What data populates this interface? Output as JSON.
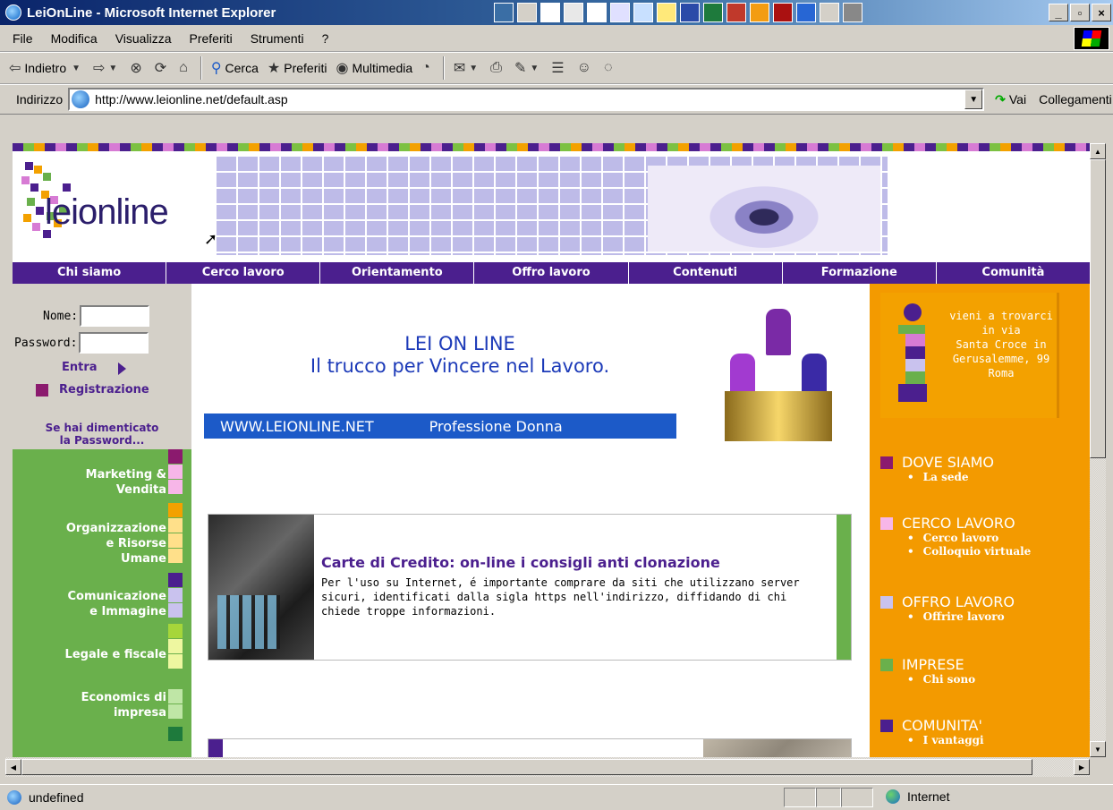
{
  "window": {
    "title": "LeiOnLine - Microsoft Internet Explorer"
  },
  "menubar": {
    "items": [
      "File",
      "Modifica",
      "Visualizza",
      "Preferiti",
      "Strumenti",
      "?"
    ]
  },
  "toolbar": {
    "back_label": "Indietro",
    "search_label": "Cerca",
    "favorites_label": "Preferiti",
    "media_label": "Multimedia"
  },
  "addressbar": {
    "label": "Indirizzo",
    "url": "http://www.leionline.net/default.asp",
    "go_label": "Vai",
    "links_label": "Collegamenti"
  },
  "site": {
    "logo_text": "leionline",
    "nav": [
      "Chi siamo",
      "Cerco lavoro",
      "Orientamento",
      "Offro lavoro",
      "Contenuti",
      "Formazione",
      "Comunità"
    ],
    "login": {
      "name_label": "Nome:",
      "password_label": "Password:",
      "enter_label": "Entra",
      "register_label": "Registrazione",
      "forgot_line1": "Se hai dimenticato",
      "forgot_line2": "la Password..."
    },
    "topics": [
      {
        "line1": "Marketing &",
        "line2": "Vendita"
      },
      {
        "line1": "Organizzazione",
        "line2": "e Risorse",
        "line3": "Umane"
      },
      {
        "line1": "Comunicazione",
        "line2": "e Immagine"
      },
      {
        "line1": "Legale e fiscale"
      },
      {
        "line1": "Economics di",
        "line2": "impresa"
      }
    ],
    "ad": {
      "line1": "LEI ON LINE",
      "line2": "Il trucco per Vincere nel Lavoro.",
      "bar_url": "WWW.LEIONLINE.NET",
      "bar_tag": "Professione Donna"
    },
    "article": {
      "title": "Carte di Credito: on-line i consigli anti clonazione",
      "body": "Per l'uso su Internet, é importante comprare da siti che utilizzano server sicuri, identificati dalla sigla https nell'indirizzo, diffidando di chi chiede troppe informazioni."
    },
    "info": {
      "line1": "vieni a trovarci",
      "line2": "in via",
      "line3": "Santa Croce in",
      "line4": "Gerusalemme, 99",
      "line5": "Roma"
    },
    "right_sections": [
      {
        "title": "DOVE SIAMO",
        "links": [
          "La sede"
        ],
        "color": "#8b1a6e"
      },
      {
        "title": "CERCO LAVORO",
        "links": [
          "Cerco lavoro",
          "Colloquio virtuale"
        ],
        "color": "#f7b6e8"
      },
      {
        "title": "OFFRO LAVORO",
        "links": [
          "Offrire lavoro"
        ],
        "color": "#c9c2ee"
      },
      {
        "title": "IMPRESE",
        "links": [
          "Chi sono"
        ],
        "color": "#6ab04c"
      },
      {
        "title": "COMUNITA'",
        "links": [
          "I vantaggi"
        ],
        "color": "#4b1f8e"
      }
    ]
  },
  "statusbar": {
    "text": "undefined",
    "zone": "Internet"
  },
  "colors": {
    "purple": "#4b1f8e",
    "orange": "#f39a00",
    "green": "#6ab04c",
    "blue": "#1c5ac8"
  }
}
